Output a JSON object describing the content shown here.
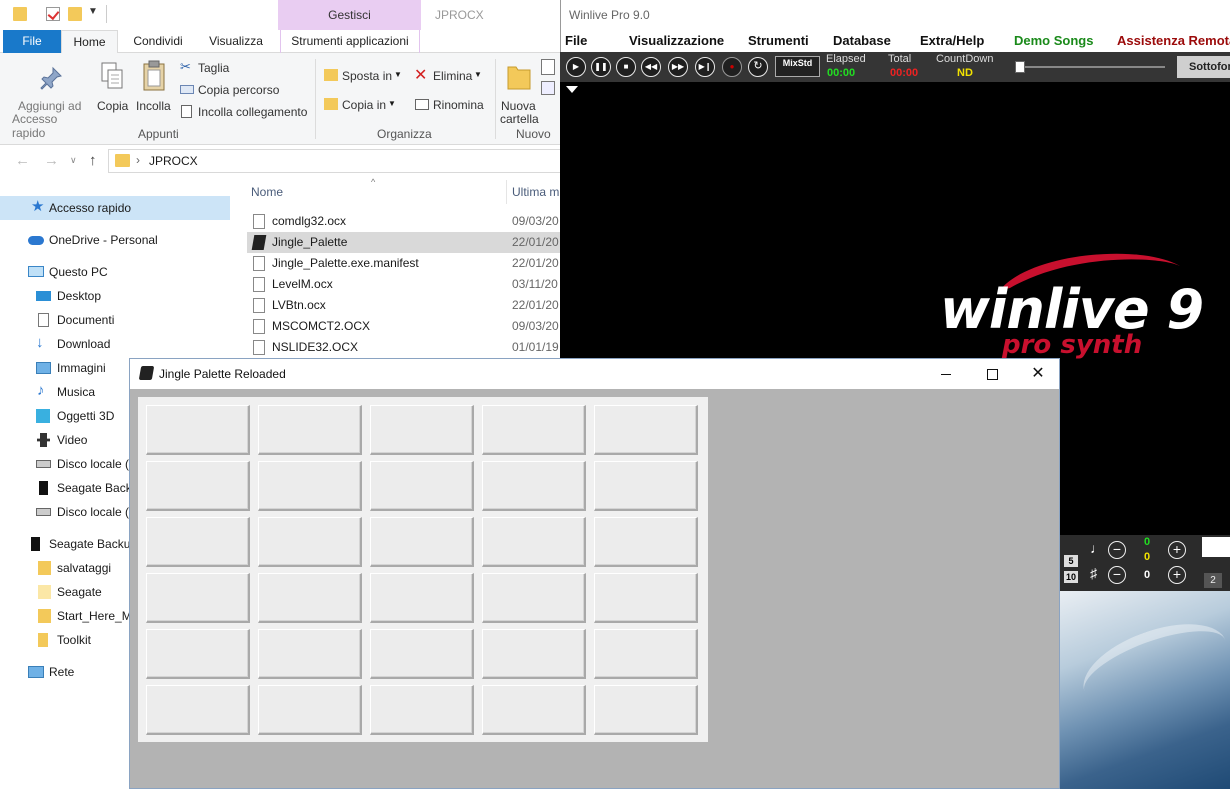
{
  "explorer": {
    "title": "JPROCX",
    "gestisci_tab": "Gestisci",
    "tabs": [
      "File",
      "Home",
      "Condividi",
      "Visualizza",
      "Strumenti applicazioni"
    ],
    "ribbon": {
      "pin_label_1": "Aggiungi ad",
      "pin_label_2": "Accesso rapido",
      "copy": "Copia",
      "paste": "Incolla",
      "cut": "Taglia",
      "copy_path": "Copia percorso",
      "paste_link": "Incolla collegamento",
      "group_clipboard": "Appunti",
      "move_to": "Sposta in",
      "copy_to": "Copia in",
      "delete": "Elimina",
      "rename": "Rinomina",
      "group_organize": "Organizza",
      "new_folder_1": "Nuova",
      "new_folder_2": "cartella",
      "group_new": "Nuovo"
    },
    "address": "JPROCX",
    "nav": {
      "quick_access": "Accesso rapido",
      "onedrive": "OneDrive - Personal",
      "this_pc": "Questo PC",
      "desktop": "Desktop",
      "documents": "Documenti",
      "download": "Download",
      "pictures": "Immagini",
      "music": "Musica",
      "objects3d": "Oggetti 3D",
      "video": "Video",
      "local_disk_c": "Disco locale (C",
      "seagate_backup_drive": "Seagate Backu",
      "local_disk_f": "Disco locale (F",
      "seagate_backup": "Seagate Backup",
      "salvataggi": "salvataggi",
      "seagate": "Seagate",
      "start_here": "Start_Here_Ma",
      "toolkit": "Toolkit",
      "network": "Rete"
    },
    "columns": {
      "name": "Nome",
      "date": "Ultima m"
    },
    "files": [
      {
        "name": "comdlg32.ocx",
        "date": "09/03/20"
      },
      {
        "name": "Jingle_Palette",
        "date": "22/01/20"
      },
      {
        "name": "Jingle_Palette.exe.manifest",
        "date": "22/01/20"
      },
      {
        "name": "LevelM.ocx",
        "date": "03/11/20"
      },
      {
        "name": "LVBtn.ocx",
        "date": "22/01/20"
      },
      {
        "name": "MSCOMCT2.OCX",
        "date": "09/03/20"
      },
      {
        "name": "NSLIDE32.OCX",
        "date": "01/01/19"
      }
    ]
  },
  "winlive": {
    "title": "Winlive Pro 9.0",
    "menu": {
      "file": "File",
      "view": "Visualizzazione",
      "tools": "Strumenti",
      "database": "Database",
      "extra": "Extra/Help",
      "demo": "Demo Songs",
      "remote": "Assistenza Remota"
    },
    "colors": {
      "demo": "#1a8a1a",
      "remote": "#9b0a0a",
      "elapsed": "#22dd22",
      "total": "#ee2222",
      "countdown": "#f2e200"
    },
    "toolbar": {
      "mixstd": "MixStd",
      "elapsed_label": "Elapsed",
      "elapsed_value": "00:00",
      "total_label": "Total",
      "total_value": "00:00",
      "countdown_label": "CountDown",
      "countdown_value": "ND",
      "sottofondo": "Sottofondo"
    },
    "logo_main": "winlive 9",
    "logo_sub": "pro synth",
    "panel": {
      "num_top": "5",
      "num_bottom": "10",
      "tempo_top": "0",
      "tempo_mid": "0",
      "transpose": "0",
      "tab": "2"
    }
  },
  "jingle": {
    "title": "Jingle Palette Reloaded",
    "grid_rows": 6,
    "grid_cols": 5
  }
}
